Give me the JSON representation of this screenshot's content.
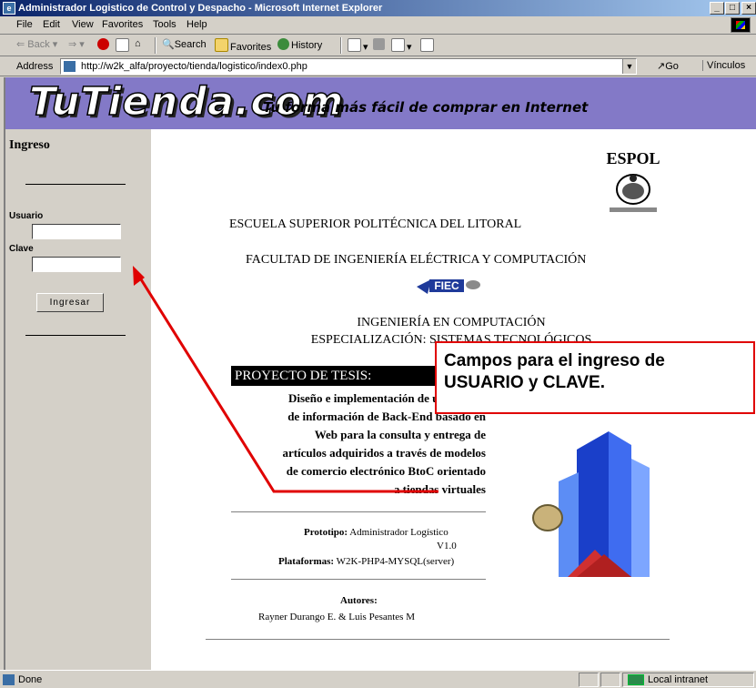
{
  "window": {
    "title": "Administrador Logistico de Control y Despacho - Microsoft Internet Explorer",
    "buttons": {
      "minimize": "_",
      "maximize": "□",
      "close": "×"
    }
  },
  "menu": [
    "File",
    "Edit",
    "View",
    "Favorites",
    "Tools",
    "Help"
  ],
  "toolbar": {
    "back": "Back",
    "search": "Search",
    "favorites": "Favorites",
    "history": "History"
  },
  "address": {
    "label": "Address",
    "url": "http://w2k_alfa/proyecto/tienda/logistico/index0.php",
    "go": "Go",
    "links": "Vínculos"
  },
  "banner": {
    "logo": "TuTienda.com",
    "tagline": "Tu forma más fácil de comprar en Internet",
    "color": "#8379c7"
  },
  "sidebar": {
    "title": "Ingreso",
    "user_label": "Usuario",
    "user_value": "",
    "password_label": "Clave",
    "password_value": "",
    "submit": "Ingresar"
  },
  "main": {
    "university": "ESCUELA SUPERIOR POLITÉCNICA DEL LITORAL",
    "faculty": "FACULTAD DE INGENIERÍA ELÉCTRICA Y COMPUTACIÓN",
    "fiec_logo": "FIEC",
    "espol_logo": "ESPOL",
    "career": "INGENIERÍA EN COMPUTACIÓN",
    "specialization": "ESPECIALIZACIÓN: SISTEMAS TECNOLÓGICOS",
    "thesis_header": "PROYECTO DE TESIS:",
    "thesis_lines": [
      "Diseño e implementación de un sistema",
      "de información de Back-End basado en",
      "Web para la consulta y entrega de",
      "artículos adquiridos a través de modelos",
      "de comercio electrónico BtoC  orientado",
      "a tiendas virtuales"
    ],
    "prototype_label": "Prototipo:",
    "prototype_value": "Administrador Logístico",
    "version": "V1.0",
    "platforms_label": "Plataformas:",
    "platforms_value": "W2K-PHP4-MYSQL(server)",
    "authors_label": "Autores:",
    "authors": "Rayner Durango E.  &   Luis Pesantes M"
  },
  "callout": {
    "line1": "Campos para el ingreso de",
    "line2": "USUARIO y CLAVE.",
    "color": "#e00000"
  },
  "status": {
    "text": "Done",
    "zone": "Local intranet"
  }
}
